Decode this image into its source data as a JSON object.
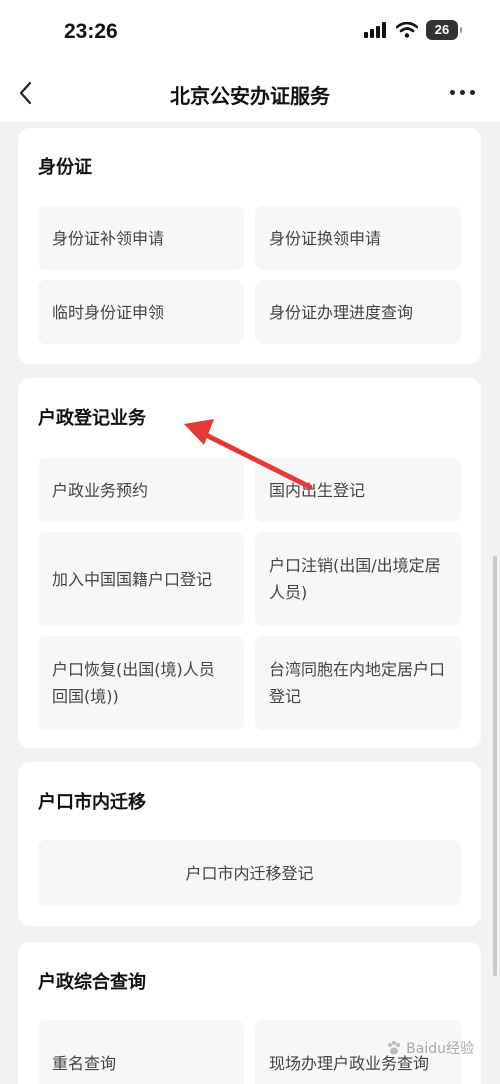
{
  "status": {
    "time": "23:26",
    "battery": "26"
  },
  "nav": {
    "title": "北京公安办证服务"
  },
  "sections": {
    "id_card": {
      "title": "身份证",
      "items": [
        "身份证补领申请",
        "身份证换领申请",
        "临时身份证申领",
        "身份证办理进度查询"
      ]
    },
    "household": {
      "title": "户政登记业务",
      "items": [
        "户政业务预约",
        "国内出生登记",
        "加入中国国籍户口登记",
        "户口注销(出国/出境定居人员)",
        "户口恢复(出国(境)人员回国(境))",
        "台湾同胞在内地定居户口登记"
      ]
    },
    "migration": {
      "title": "户口市内迁移",
      "items": [
        "户口市内迁移登记"
      ]
    },
    "query": {
      "title": "户政综合查询",
      "items": [
        "重名查询",
        "现场办理户政业务查询"
      ]
    }
  },
  "watermark": "Baidu经验"
}
